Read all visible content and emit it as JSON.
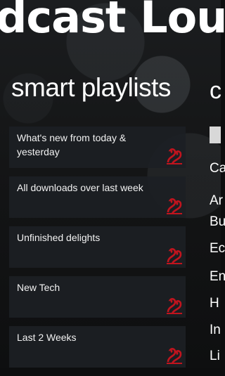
{
  "app": {
    "title": "dcast Lou"
  },
  "section": {
    "title": "smart playlists"
  },
  "playlists": [
    {
      "label": "What's new from today & yesterday"
    },
    {
      "label": "All downloads over last week"
    },
    {
      "label": "Unfinished delights"
    },
    {
      "label": "New Tech"
    },
    {
      "label": "Last 2 Weeks"
    }
  ],
  "next_panel": {
    "title": "c",
    "categories": [
      "Ca",
      "Ar",
      "Bu",
      "Ec",
      "En",
      "H",
      "In",
      "Li"
    ]
  },
  "colors": {
    "accent": "#c0141e",
    "tile": "#1c2024"
  }
}
